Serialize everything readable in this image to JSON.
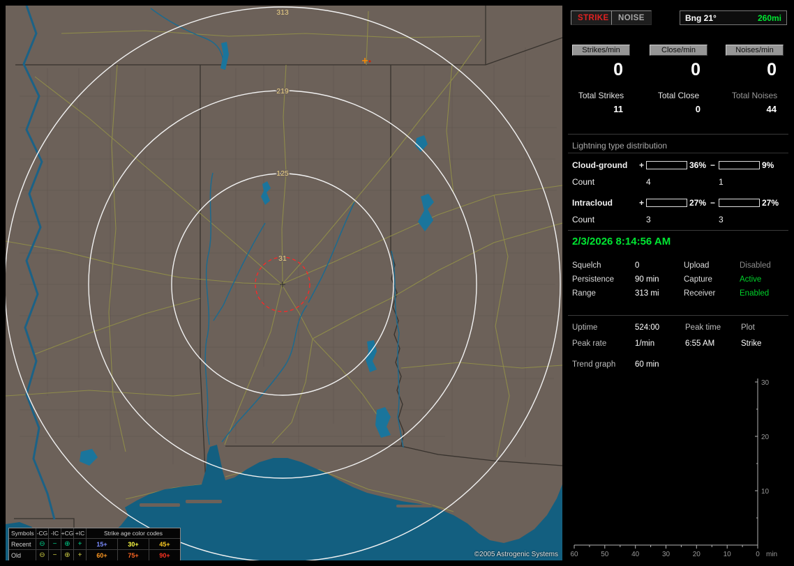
{
  "colors": {
    "accent_green": "#00e632",
    "strike_red": "#e22222",
    "disabled_gray": "#8b8b8b"
  },
  "map": {
    "rings": [
      "313",
      "219",
      "125",
      "31"
    ],
    "copyright": "©2005 Astrogenic Systems",
    "legend": {
      "symbols_header": "Symbols",
      "age_header": "Strike age color codes",
      "symbol_cols": [
        "-CG",
        "-IC",
        "+CG",
        "+IC"
      ],
      "glyphs": [
        "⊖",
        "−",
        "⊕",
        "+"
      ],
      "rows": [
        {
          "label": "Recent",
          "symbol_color": "#00cc88",
          "ages": [
            "15+",
            "30+",
            "45+"
          ],
          "age_colors": [
            "#7a8cff",
            "#ffff44",
            "#ffcc22"
          ]
        },
        {
          "label": "Old",
          "symbol_color": "#cccc44",
          "ages": [
            "60+",
            "75+",
            "90+"
          ],
          "age_colors": [
            "#ff9922",
            "#ff6622",
            "#ff3322"
          ]
        }
      ]
    }
  },
  "panel": {
    "mode": {
      "strike": "STRIKE",
      "noise": "NOISE"
    },
    "bearing": {
      "label": "Bng 21°",
      "range": "260mi"
    },
    "rates": [
      {
        "label": "Strikes/min",
        "value": "0"
      },
      {
        "label": "Close/min",
        "value": "0"
      },
      {
        "label": "Noises/min",
        "value": "0"
      }
    ],
    "totals": [
      {
        "label": "Total Strikes",
        "value": "11",
        "color": "#e4e4e4"
      },
      {
        "label": "Total Close",
        "value": "0",
        "color": "#e4e4e4"
      },
      {
        "label": "Total Noises",
        "value": "44",
        "color": "#999999"
      }
    ],
    "distribution": {
      "title": "Lightning type distribution",
      "count_label": "Count",
      "rows": [
        {
          "label": "Cloud-ground",
          "plus_pct": "36%",
          "minus_pct": "9%",
          "plus_count": "4",
          "minus_count": "1",
          "plus_fill": 36,
          "minus_fill": 9,
          "plus_color": "#ff1414",
          "minus_color": "#c8d4ff"
        },
        {
          "label": "Intracloud",
          "plus_pct": "27%",
          "minus_pct": "27%",
          "plus_count": "3",
          "minus_count": "3",
          "plus_fill": 27,
          "minus_fill": 27,
          "plus_color": "#ff6ec8",
          "minus_color": "#16e916"
        }
      ]
    },
    "datetime": "2/3/2026 8:14:56 AM",
    "settings_left": [
      {
        "label": "Squelch",
        "value": "0"
      },
      {
        "label": "Persistence",
        "value": "90 min"
      },
      {
        "label": "Range",
        "value": "313 mi"
      }
    ],
    "settings_right": [
      {
        "label": "Upload",
        "value": "Disabled",
        "color": "#8b8b8b"
      },
      {
        "label": "Capture",
        "value": "Active",
        "color": "#00d22a"
      },
      {
        "label": "Receiver",
        "value": "Enabled",
        "color": "#00d22a"
      }
    ],
    "stats": {
      "uptime_label": "Uptime",
      "uptime_value": "524:00",
      "peak_rate_label": "Peak rate",
      "peak_rate_value": "1/min",
      "peak_time_label": "Peak time",
      "peak_time_value": "6:55 AM",
      "plot_label": "Plot",
      "plot_value": "Strike"
    },
    "trend": {
      "label": "Trend graph",
      "value": "60 min"
    },
    "graph": {
      "y_ticks": [
        "30",
        "20",
        "10"
      ],
      "x_ticks": [
        "60",
        "50",
        "40",
        "30",
        "20",
        "10",
        "0"
      ],
      "unit": "min",
      "y_range": [
        0,
        30
      ]
    }
  }
}
